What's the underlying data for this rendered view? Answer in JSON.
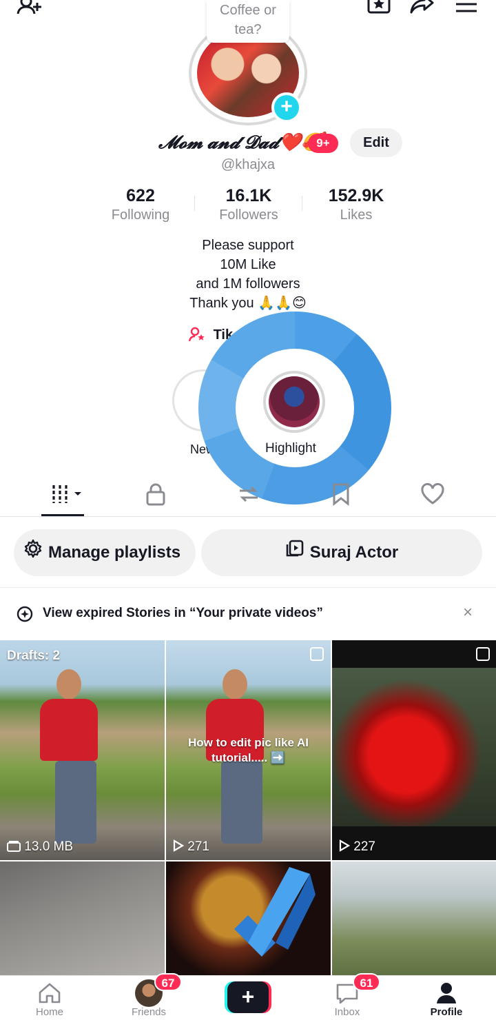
{
  "header": {
    "add_friend_icon": "person-plus-icon",
    "favorites_icon": "star-icon",
    "share_icon": "share-arrow-icon",
    "menu_icon": "hamburger-menu-icon"
  },
  "profile": {
    "note_bubble": "Coffee or tea?",
    "display_name": "𝓜𝓸𝓶 𝓪𝓷𝓭 𝓓𝓪𝓭❤️🥰",
    "notification_badge": "9+",
    "edit_label": "Edit",
    "handle": "@khajxa",
    "stats": [
      {
        "value": "622",
        "label": "Following"
      },
      {
        "value": "16.1K",
        "label": "Followers"
      },
      {
        "value": "152.9K",
        "label": "Likes"
      }
    ],
    "bio": [
      "Please support",
      "10M Like",
      "and 1M followers",
      "Thank you 🙏🙏😊"
    ],
    "tiktok_link_label": "Tik"
  },
  "stories": {
    "new_label": "New",
    "new_symbol": "+",
    "highlight_label": "Highlight"
  },
  "tabs": [
    {
      "name": "videos",
      "icon": "grid-bars-icon",
      "active": true
    },
    {
      "name": "private",
      "icon": "lock-icon",
      "active": false
    },
    {
      "name": "reposts",
      "icon": "repost-icon",
      "active": false
    },
    {
      "name": "saved",
      "icon": "bookmark-icon",
      "active": false
    },
    {
      "name": "liked",
      "icon": "heart-icon",
      "active": false
    }
  ],
  "playlists": {
    "manage_label": "Manage playlists",
    "playlist_label": "Suraj Actor"
  },
  "notice": {
    "text": "View expired Stories in “Your private videos”",
    "close": "×"
  },
  "videos": [
    {
      "overlay_top": "Drafts: 2",
      "bottom": "13.0 MB",
      "bottom_icon": "draft-folder-icon"
    },
    {
      "caption": "How to edit pic like AI tutorial..... ➡️",
      "bottom": "271",
      "bottom_icon": "play-icon"
    },
    {
      "bottom": "227",
      "bottom_icon": "play-icon"
    },
    {},
    {},
    {}
  ],
  "bottom_nav": [
    {
      "label": "Home",
      "icon": "home-icon"
    },
    {
      "label": "Friends",
      "icon": "friends-avatar-icon",
      "badge": "67"
    },
    {
      "label": "",
      "icon": "plus-icon",
      "symbol": "+"
    },
    {
      "label": "Inbox",
      "icon": "inbox-icon",
      "badge": "61"
    },
    {
      "label": "Profile",
      "icon": "profile-icon",
      "active": true
    }
  ],
  "colors": {
    "accent_red": "#fe2c55",
    "accent_cyan": "#20d5ec",
    "text_primary": "#161823",
    "text_secondary": "#8a8b91"
  }
}
